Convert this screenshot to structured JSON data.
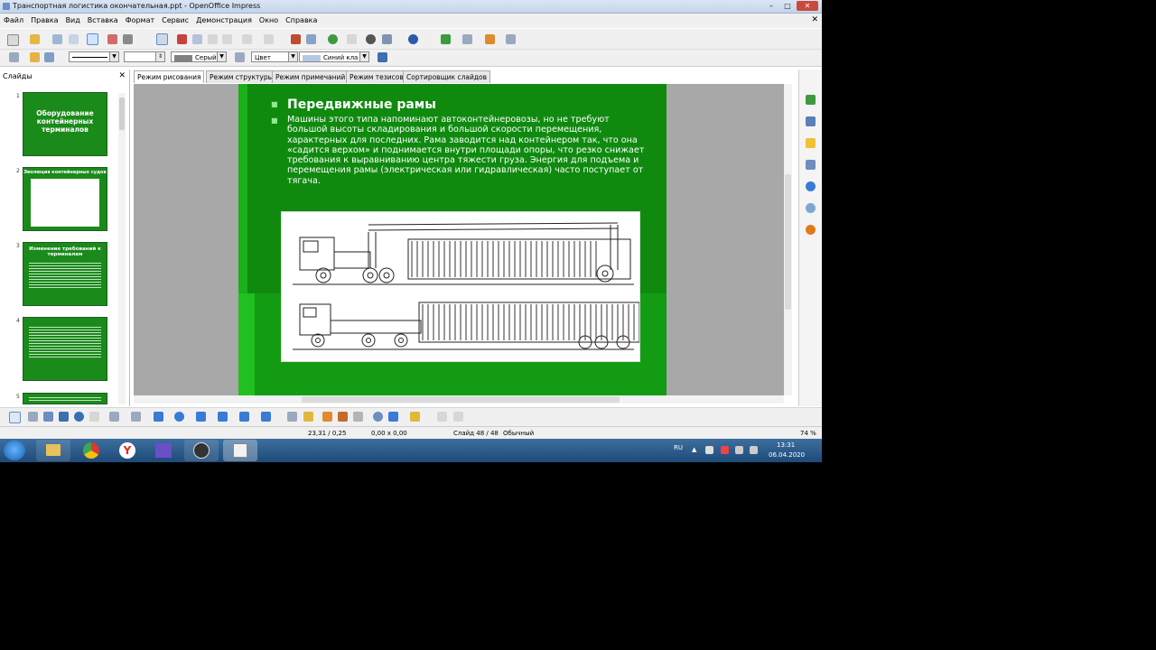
{
  "window": {
    "title": "Транспортная логистика окончательная.ppt - OpenOffice Impress",
    "minimize": "–",
    "maximize": "□",
    "close": "✕"
  },
  "menu": [
    "Файл",
    "Правка",
    "Вид",
    "Вставка",
    "Формат",
    "Сервис",
    "Демонстрация",
    "Окно",
    "Справка"
  ],
  "menu_close": "✕",
  "toolbar2": {
    "line_color": "Серый",
    "area_label": "Цвет",
    "area_color": "Синий кла"
  },
  "slides_pane": {
    "title": "Слайды",
    "close": "✕",
    "slide_numbers": [
      "1",
      "2",
      "3",
      "4",
      "5"
    ],
    "thumb1_title": "Оборудование контейнерных терминалов",
    "thumb2_title": "Эволюция контейнерных судов",
    "thumb3_title": "Изменение требований к терминалам"
  },
  "tabs": [
    "Режим рисования",
    "Режим структуры",
    "Режим примечаний",
    "Режим тезисов",
    "Сортировщик слайдов"
  ],
  "slide": {
    "title": "Передвижные рамы",
    "body": "Машины этого типа напоминают автоконтейнеровозы, но не требуют большой высоты складирования и большой скорости перемещения, характерных для последних. Рама заводится над контейнером так, что она «садится верхом» и поднимается внутри площади опоры, что резко снижает требования к выравниванию центра тяжести груза. Энергия для подъема и перемещения рамы (электрическая или гидравлическая) часто поступает от тягача."
  },
  "statusbar": {
    "position": "23,31 / 0,25",
    "size": "0,00 x 0,00",
    "slide": "Слайд 48 / 48",
    "layout": "Обычный",
    "zoom": "74 %"
  },
  "taskbar": {
    "lang": "RU",
    "time": "13:31",
    "date": "06.04.2020"
  }
}
